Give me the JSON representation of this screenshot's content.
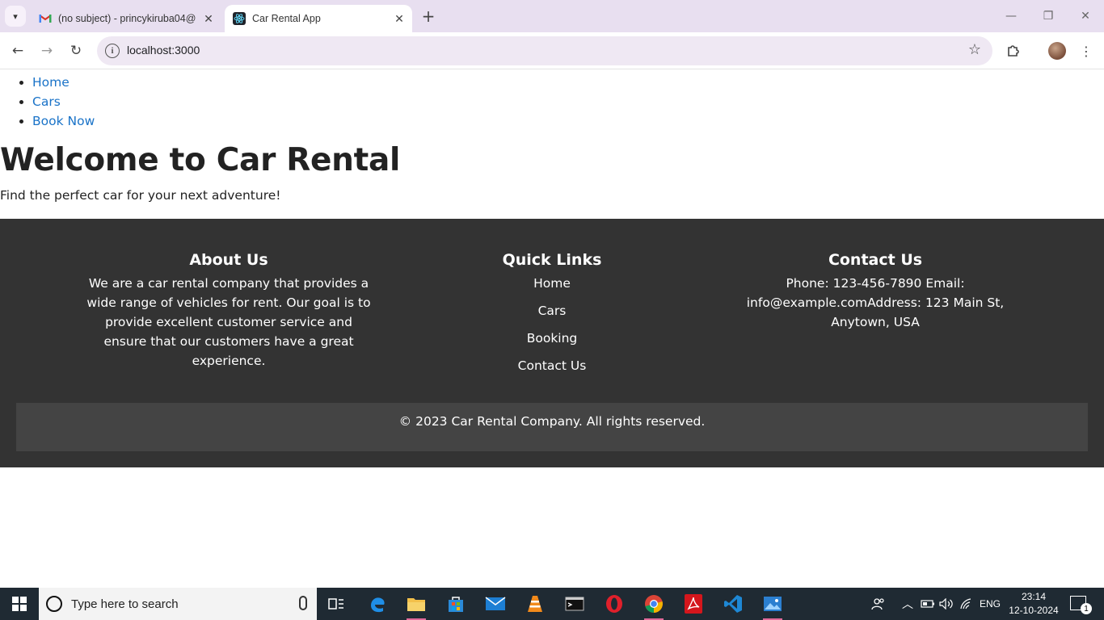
{
  "browser": {
    "tabs": [
      {
        "title": "(no subject) - princykiruba04@",
        "favicon": "gmail-icon",
        "active": false
      },
      {
        "title": "Car Rental App",
        "favicon": "react-icon",
        "active": true
      }
    ],
    "url": "localhost:3000"
  },
  "page": {
    "nav": [
      {
        "label": "Home"
      },
      {
        "label": "Cars"
      },
      {
        "label": "Book Now"
      }
    ],
    "hero_title": "Welcome to Car Rental",
    "hero_subtitle": "Find the perfect car for your next adventure!"
  },
  "footer": {
    "about": {
      "title": "About Us",
      "text": "We are a car rental company that provides a wide range of vehicles for rent. Our goal is to provide excellent customer service and ensure that our customers have a great experience."
    },
    "quick_links": {
      "title": "Quick Links",
      "links": [
        "Home",
        "Cars",
        "Booking",
        "Contact Us"
      ]
    },
    "contact": {
      "title": "Contact Us",
      "text": "Phone: 123-456-7890 Email: info@example.comAddress: 123 Main St, Anytown, USA"
    },
    "copyright": "© 2023 Car Rental Company. All rights reserved."
  },
  "taskbar": {
    "search_placeholder": "Type here to search",
    "language": "ENG",
    "time": "23:14",
    "date": "12-10-2024",
    "notification_count": "1"
  },
  "colors": {
    "footer_bg": "#333333",
    "copyright_bg": "#444444",
    "link": "#1a73c8",
    "tabstrip": "#e8dff0"
  }
}
